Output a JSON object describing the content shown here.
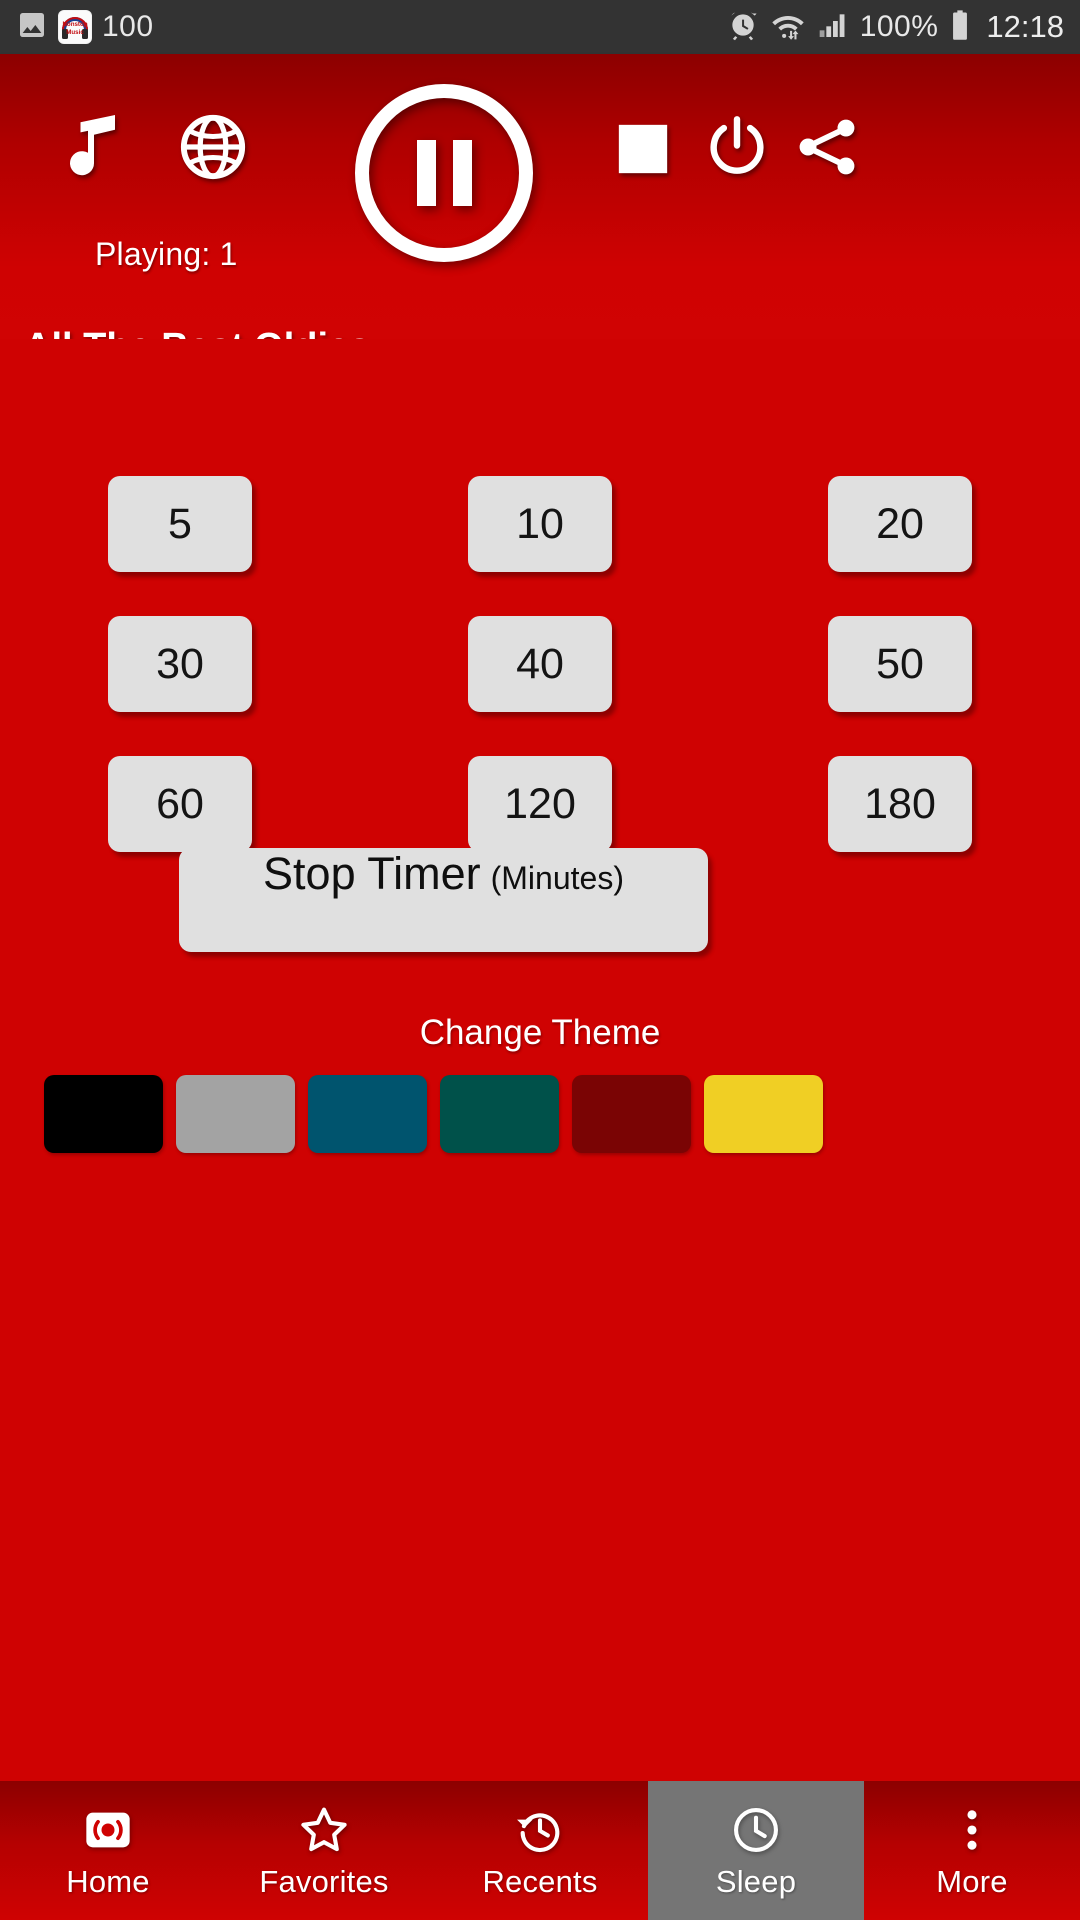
{
  "status_bar": {
    "left_icons": [
      "image-icon",
      "nonstop-music-app-icon"
    ],
    "notification_count": "100",
    "app_icon_text_top": "Nonstop",
    "app_icon_text_bottom": "Music",
    "right_icons": [
      "alarm-icon",
      "wifi-icon",
      "signal-icon",
      "battery-icon"
    ],
    "battery_percent": "100%",
    "time": "12:18"
  },
  "header": {
    "music_icon": "music-note-icon",
    "globe_icon": "globe-icon",
    "play_pause_icon": "pause-icon",
    "stop_icon": "stop-square-icon",
    "power_icon": "power-icon",
    "share_icon": "share-icon",
    "playing_label": "Playing: 1",
    "station_title": "All The Best Oldies",
    "background_color": "#cf0202"
  },
  "sleep_timer": {
    "buttons": [
      "5",
      "10",
      "20",
      "30",
      "40",
      "50",
      "60",
      "120",
      "180"
    ],
    "stop_timer_label": "Stop Timer",
    "stop_timer_unit": "(Minutes)"
  },
  "theme": {
    "label": "Change Theme",
    "swatches": [
      {
        "name": "black",
        "color": "#000000"
      },
      {
        "name": "gray",
        "color": "#a3a3a3"
      },
      {
        "name": "blue",
        "color": "#00546e"
      },
      {
        "name": "green",
        "color": "#00514a"
      },
      {
        "name": "maroon",
        "color": "#7a0404"
      },
      {
        "name": "yellow",
        "color": "#f0cf24"
      }
    ]
  },
  "bottom_nav": {
    "items": [
      {
        "label": "Home",
        "icon": "broadcast-icon",
        "active": false
      },
      {
        "label": "Favorites",
        "icon": "star-icon",
        "active": false
      },
      {
        "label": "Recents",
        "icon": "history-icon",
        "active": false
      },
      {
        "label": "Sleep",
        "icon": "clock-icon",
        "active": true
      },
      {
        "label": "More",
        "icon": "more-vert-icon",
        "active": false
      }
    ],
    "active_color": "#757575"
  }
}
